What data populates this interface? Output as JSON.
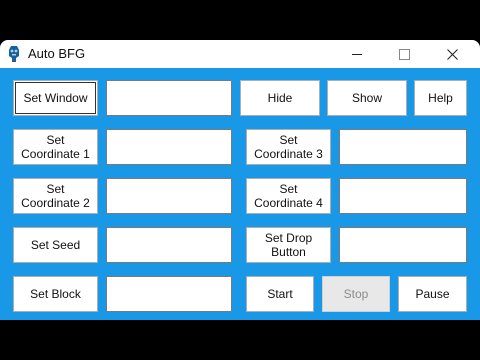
{
  "window": {
    "title": "Auto BFG",
    "icon": "robot-icon",
    "controls": [
      "minimize-icon",
      "maximize-icon",
      "close-icon"
    ]
  },
  "buttons": {
    "set_window": "Set Window",
    "hide": "Hide",
    "show": "Show",
    "help": "Help",
    "set_coordinate_1": "Set Coordinate 1",
    "set_coordinate_3": "Set Coordinate 3",
    "set_coordinate_2": "Set Coordinate 2",
    "set_coordinate_4": "Set Coordinate 4",
    "set_seed": "Set Seed",
    "set_drop_button": "Set Drop Button",
    "set_block": "Set Block",
    "start": "Start",
    "stop": "Stop",
    "pause": "Pause"
  },
  "fields": {
    "window": "",
    "coordinate_1": "",
    "coordinate_3": "",
    "coordinate_2": "",
    "coordinate_4": "",
    "seed": "",
    "drop_button": "",
    "block": ""
  },
  "colors": {
    "window_background": "#1898e6",
    "titlebar": "#ffffff",
    "outer_background": "#000000"
  }
}
